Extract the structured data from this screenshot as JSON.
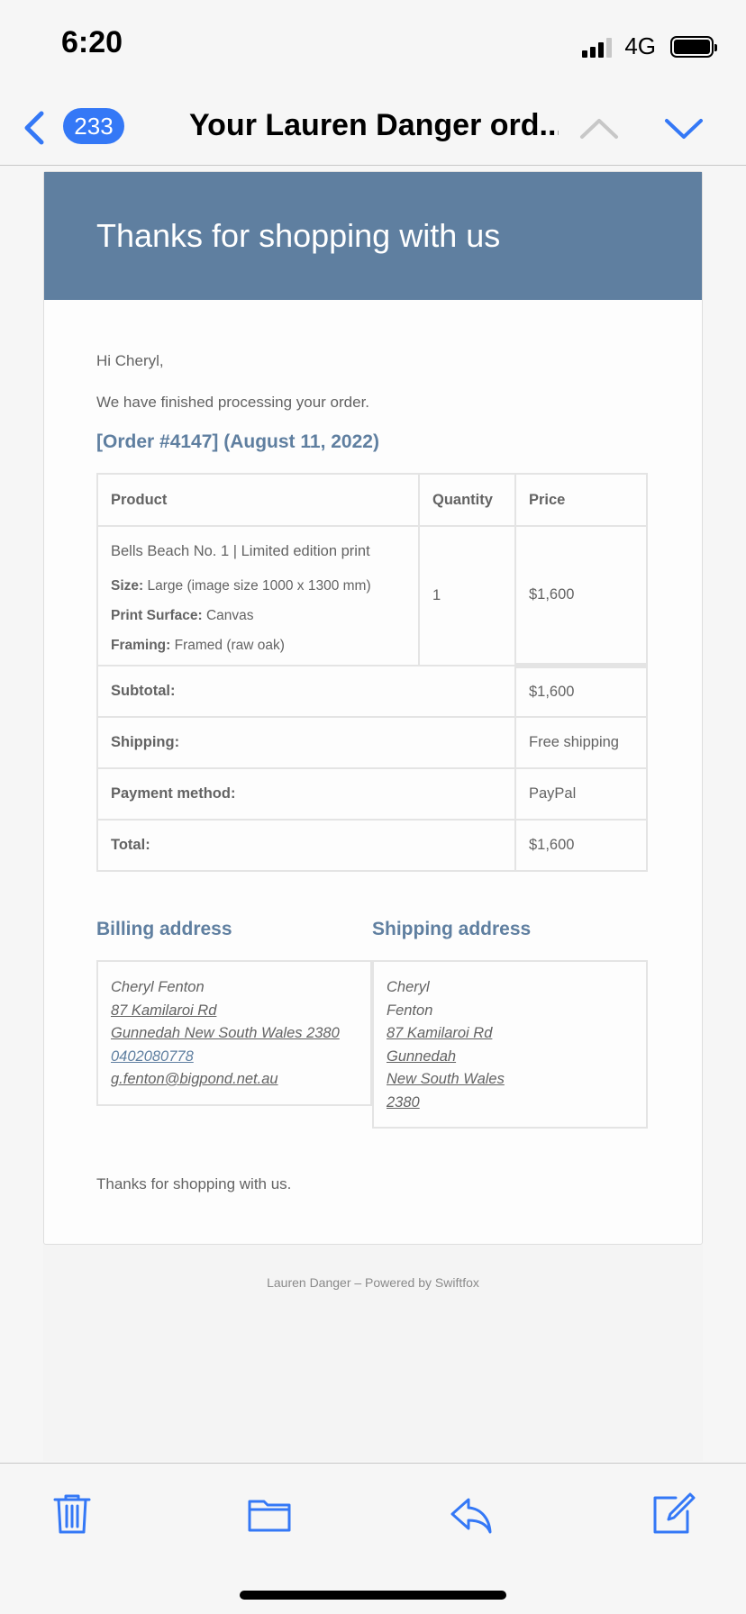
{
  "status_bar": {
    "time": "6:20",
    "network": "4G"
  },
  "nav": {
    "unread_count": "233",
    "title": "Your Lauren Danger ord..."
  },
  "email": {
    "header_title": "Thanks for shopping with us",
    "greeting": "Hi Cheryl,",
    "intro": "We have finished processing your order.",
    "order_title": "[Order #4147] (August 11, 2022)",
    "table": {
      "headers": [
        "Product",
        "Quantity",
        "Price"
      ],
      "item": {
        "name": "Bells Beach No. 1 | Limited edition print",
        "size_label": "Size:",
        "size_value": "Large (image size 1000 x 1300 mm)",
        "surface_label": "Print Surface:",
        "surface_value": "Canvas",
        "framing_label": "Framing:",
        "framing_value": "Framed (raw oak)",
        "quantity": "1",
        "price": "$1,600"
      },
      "totals": [
        {
          "label": "Subtotal:",
          "value": "$1,600"
        },
        {
          "label": "Shipping:",
          "value": "Free shipping"
        },
        {
          "label": "Payment method:",
          "value": "PayPal"
        },
        {
          "label": "Total:",
          "value": "$1,600"
        }
      ]
    },
    "billing": {
      "heading": "Billing address",
      "name": "Cheryl Fenton",
      "street": "87 Kamilaroi Rd",
      "city": "Gunnedah New South Wales 2380",
      "phone": "0402080778",
      "email": "g.fenton@bigpond.net.au"
    },
    "shipping": {
      "heading": "Shipping address",
      "first_name": "Cheryl",
      "last_name": "Fenton",
      "street": "87 Kamilaroi Rd",
      "city": "Gunnedah",
      "state": "New South Wales",
      "postcode": "2380"
    },
    "closing": "Thanks for shopping with us.",
    "footer": "Lauren Danger – Powered by Swiftfox"
  },
  "icons": {
    "back": "chevron-left-icon",
    "prev": "chevron-up-icon",
    "next": "chevron-down-icon",
    "trash": "trash-icon",
    "folder": "folder-icon",
    "reply": "reply-icon",
    "compose": "compose-icon"
  },
  "colors": {
    "accent": "#3478f6",
    "brand": "#5f7fa0"
  }
}
